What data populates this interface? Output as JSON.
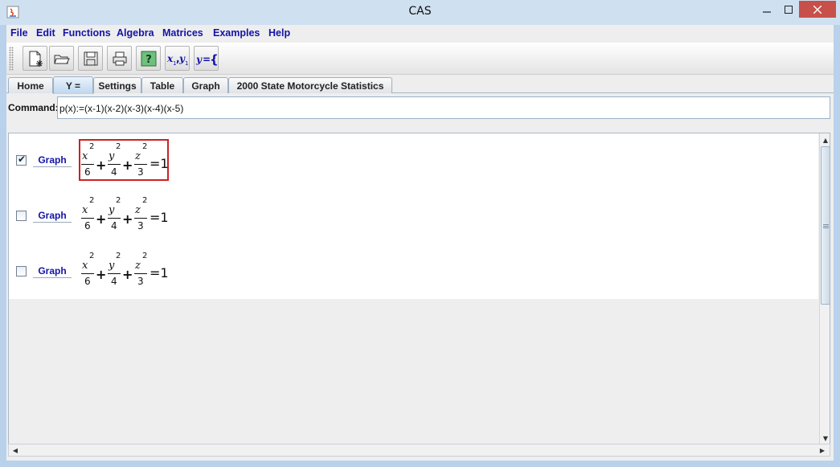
{
  "window": {
    "title": "CAS"
  },
  "menu": [
    "File",
    "Edit",
    "Functions",
    "Algebra",
    "Matrices",
    "Examples",
    "Help"
  ],
  "toolbar": {
    "buttons": [
      {
        "name": "new-icon"
      },
      {
        "name": "open-folder-icon"
      },
      {
        "name": "save-disk-icon"
      },
      {
        "name": "print-icon"
      },
      {
        "name": "help-icon"
      },
      {
        "name": "parametric-icon",
        "text": "X₁,Y₁"
      },
      {
        "name": "piecewise-icon",
        "text": "Y={"
      }
    ]
  },
  "tabs": [
    "Home",
    "Y =",
    "Settings",
    "Table",
    "Graph",
    "2000 State Motorcycle Statistics"
  ],
  "active_tab": "Y =",
  "command": {
    "label": "Command:",
    "value": "p(x):=(x-1)(x-2)(x-3)(x-4)(x-5)"
  },
  "rows": [
    {
      "checked": true,
      "graph_label": "Graph",
      "selected": true,
      "terms": [
        {
          "var": "x",
          "exp": "2",
          "den": "6"
        },
        {
          "var": "y",
          "exp": "2",
          "den": "4"
        },
        {
          "var": "z",
          "exp": "2",
          "den": "3"
        }
      ],
      "rhs": "=1"
    },
    {
      "checked": false,
      "graph_label": "Graph",
      "selected": false,
      "terms": [
        {
          "var": "x",
          "exp": "2",
          "den": "6"
        },
        {
          "var": "y",
          "exp": "2",
          "den": "4"
        },
        {
          "var": "z",
          "exp": "2",
          "den": "3"
        }
      ],
      "rhs": "=1"
    },
    {
      "checked": false,
      "graph_label": "Graph",
      "selected": false,
      "terms": [
        {
          "var": "x",
          "exp": "2",
          "den": "6"
        },
        {
          "var": "y",
          "exp": "2",
          "den": "4"
        },
        {
          "var": "z",
          "exp": "2",
          "den": "3"
        }
      ],
      "rhs": "=1"
    }
  ],
  "plus_sign": "+",
  "colors": {
    "menu_text": "#1313a8",
    "selection_border": "#cc2222",
    "active_tab": "#bcd6ef",
    "title_bar": "#cfe0f1"
  }
}
